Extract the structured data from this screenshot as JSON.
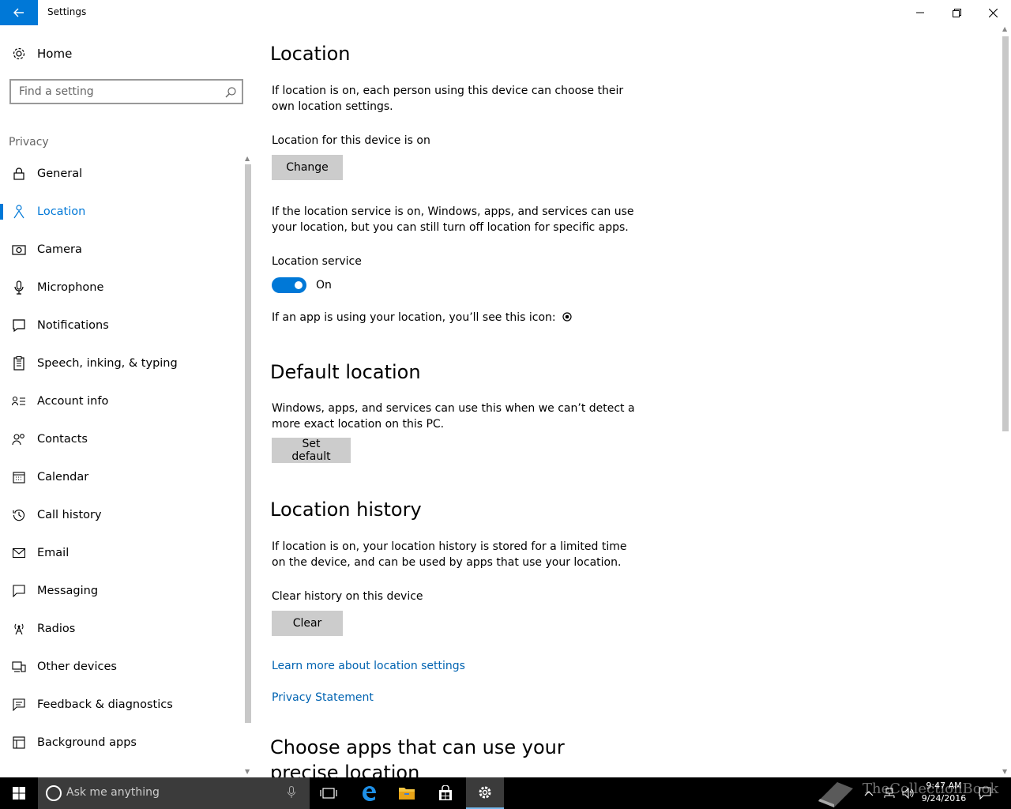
{
  "window": {
    "title": "Settings"
  },
  "sidebar": {
    "home_label": "Home",
    "search_placeholder": "Find a setting",
    "section": "Privacy",
    "items": [
      {
        "label": "General",
        "icon": "lock-icon"
      },
      {
        "label": "Location",
        "icon": "location-person-icon",
        "active": true
      },
      {
        "label": "Camera",
        "icon": "camera-icon"
      },
      {
        "label": "Microphone",
        "icon": "microphone-icon"
      },
      {
        "label": "Notifications",
        "icon": "notification-icon"
      },
      {
        "label": "Speech, inking, & typing",
        "icon": "clipboard-icon"
      },
      {
        "label": "Account info",
        "icon": "contact-info-icon"
      },
      {
        "label": "Contacts",
        "icon": "people-icon"
      },
      {
        "label": "Calendar",
        "icon": "calendar-icon"
      },
      {
        "label": "Call history",
        "icon": "history-icon"
      },
      {
        "label": "Email",
        "icon": "mail-icon"
      },
      {
        "label": "Messaging",
        "icon": "message-icon"
      },
      {
        "label": "Radios",
        "icon": "radio-tower-icon"
      },
      {
        "label": "Other devices",
        "icon": "devices-icon"
      },
      {
        "label": "Feedback & diagnostics",
        "icon": "feedback-icon"
      },
      {
        "label": "Background apps",
        "icon": "background-apps-icon"
      }
    ]
  },
  "main": {
    "location": {
      "title": "Location",
      "intro": "If location is on, each person using this device can choose their own location settings.",
      "device_status": "Location for this device is on",
      "change_button": "Change",
      "service_desc": "If the location service is on, Windows, apps, and services can use your location, but you can still turn off location for specific apps.",
      "service_label": "Location service",
      "service_state": "On",
      "service_on": true,
      "icon_note": "If an app is using your location, you’ll see this icon:"
    },
    "default_location": {
      "title": "Default location",
      "desc": "Windows, apps, and services can use this when we can’t detect a more exact location on this PC.",
      "button": "Set default"
    },
    "history": {
      "title": "Location history",
      "desc": "If location is on, your location history is stored for a limited time on the device, and can be used by apps that use your location.",
      "clear_label": "Clear history on this device",
      "clear_button": "Clear"
    },
    "links": {
      "learn_more": "Learn more about location settings",
      "privacy": "Privacy Statement"
    },
    "apps_section_title": "Choose apps that can use your precise location"
  },
  "taskbar": {
    "search_placeholder": "Ask me anything",
    "time": "9:47 AM",
    "date": "9/24/2016",
    "watermark": "TheCollectionBook"
  },
  "colors": {
    "accent": "#0078d7",
    "link": "#0063b1",
    "button_bg": "#cccccc",
    "taskbar": "#000000"
  }
}
